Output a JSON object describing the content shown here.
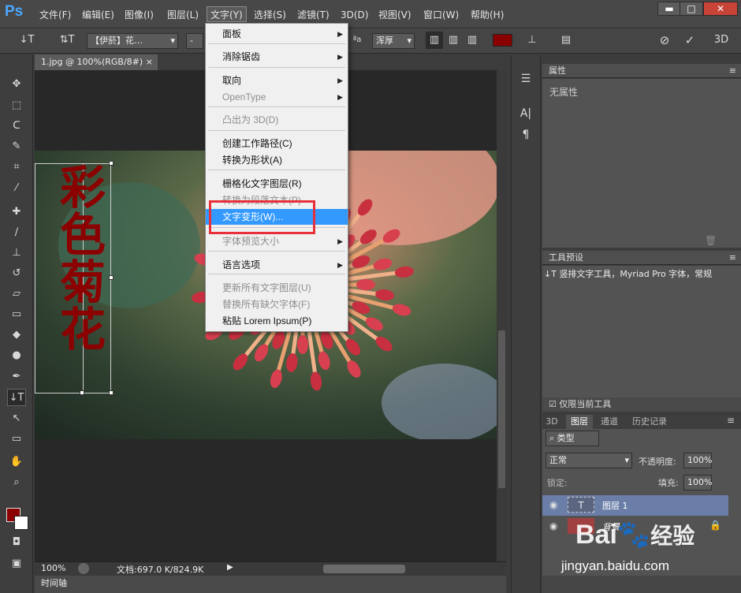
{
  "app": {
    "logo": "Ps"
  },
  "menubar": [
    "文件(F)",
    "编辑(E)",
    "图像(I)",
    "图层(L)",
    "文字(Y)",
    "选择(S)",
    "滤镜(T)",
    "3D(D)",
    "视图(V)",
    "窗口(W)",
    "帮助(H)"
  ],
  "window_controls": {
    "minimize": "▬",
    "maximize": "□",
    "close": "✕"
  },
  "options": {
    "tool_glyph": "↓T",
    "orient_glyph": "⇅T",
    "font_family": "【伊菸】花…",
    "font_style": "-",
    "aa_glyph": "ªa",
    "antialias": "浑厚",
    "text_color": "#8b0000",
    "threed_label": "3D"
  },
  "document": {
    "tab_title": "1.jpg @ 100%(RGB/8#)",
    "tab_close": "×",
    "vertical_text": [
      "彩",
      "色",
      "菊",
      "花"
    ],
    "text_color": "#8b0000"
  },
  "status": {
    "zoom": "100%",
    "doc_size": "文档:697.0 K/824.9K"
  },
  "timeline_label": "时间轴",
  "dropdown": {
    "items": [
      {
        "label": "面板",
        "submenu": true,
        "disabled": false
      },
      {
        "label": "消除锯齿",
        "submenu": true,
        "disabled": false
      },
      {
        "label": "取向",
        "submenu": true,
        "disabled": false
      },
      {
        "label": "OpenType",
        "submenu": true,
        "disabled": true
      },
      {
        "label": "凸出为 3D(D)",
        "submenu": false,
        "disabled": true
      },
      {
        "label": "创建工作路径(C)",
        "submenu": false,
        "disabled": false
      },
      {
        "label": "转换为形状(A)",
        "submenu": false,
        "disabled": false
      },
      {
        "label": "栅格化文字图层(R)",
        "submenu": false,
        "disabled": false
      },
      {
        "label": "转换为段落文本(P)",
        "submenu": false,
        "disabled": true
      },
      {
        "label": "文字变形(W)...",
        "submenu": false,
        "disabled": false,
        "highlighted": true
      },
      {
        "label": "字体预览大小",
        "submenu": true,
        "disabled": true
      },
      {
        "label": "语言选项",
        "submenu": true,
        "disabled": false
      },
      {
        "label": "更新所有文字图层(U)",
        "submenu": false,
        "disabled": true
      },
      {
        "label": "替换所有缺欠字体(F)",
        "submenu": false,
        "disabled": true
      },
      {
        "label": "粘贴 Lorem Ipsum(P)",
        "submenu": false,
        "disabled": false
      }
    ]
  },
  "properties_panel": {
    "title": "属性",
    "empty_text": "无属性"
  },
  "tool_presets_panel": {
    "title": "工具预设",
    "preset": "竖排文字工具，Myriad Pro 字体，常规",
    "current_only_label": "仅限当前工具"
  },
  "layers_panel": {
    "tabs": [
      "3D",
      "图层",
      "通道",
      "历史记录"
    ],
    "filter_label": "类型",
    "blend_mode": "正常",
    "opacity_label": "不透明度:",
    "opacity_value": "100%",
    "lock_label": "锁定:",
    "fill_label": "填充:",
    "fill_value": "100%",
    "layers": [
      {
        "name": "图层 1",
        "thumb": "T",
        "visible": true
      },
      {
        "name": "背景",
        "thumb": "",
        "visible": true
      }
    ]
  },
  "watermark": {
    "brand": "Bai",
    "brand2": "经验",
    "url": "jingyan.baidu.com"
  },
  "colors": {
    "highlight": "#3399ff",
    "red_box": "#e8303a",
    "accent": "#4aa8ff"
  }
}
